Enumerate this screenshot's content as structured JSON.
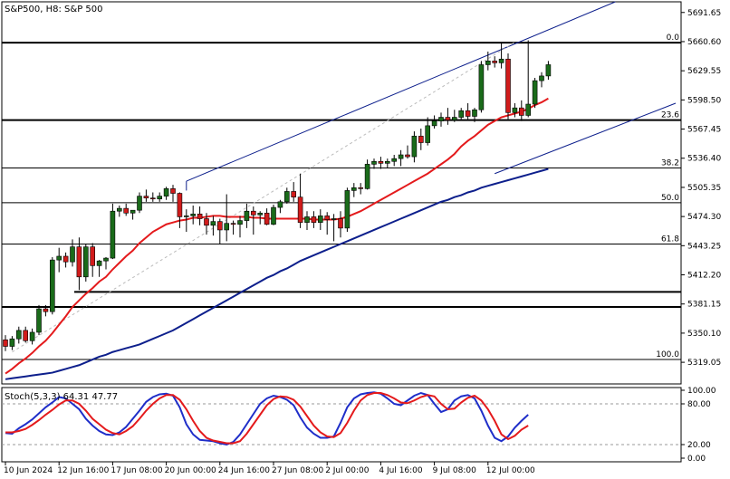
{
  "header": {
    "title": "S&P500, H8:  S&P 500"
  },
  "colors": {
    "bull": "#1a6b1a",
    "bear": "#d11b1b",
    "wick": "#000000",
    "ma_fast": "#e41a1c",
    "ma_slow": "#0d1f8c",
    "channel": "#0d1f8c",
    "level": "#000000",
    "stoch_k": "#1f2ec9",
    "stoch_d": "#e41a1c"
  },
  "chart_data": [
    {
      "type": "candlestick",
      "title": "S&P500, H8:  S&P 500",
      "ylim": [
        5296,
        5703
      ],
      "y_ticks": [
        "5691.65",
        "5660.60",
        "5629.55",
        "5598.50",
        "5567.45",
        "5536.40",
        "5505.35",
        "5474.30",
        "5443.25",
        "5412.20",
        "5381.15",
        "5350.10",
        "5319.05"
      ],
      "x_ticks": [
        {
          "label": "10 Jun 2024",
          "i": 0
        },
        {
          "label": "12 Jun 16:00",
          "i": 8
        },
        {
          "label": "17 Jun 08:00",
          "i": 16
        },
        {
          "label": "20 Jun 00:00",
          "i": 24
        },
        {
          "label": "24 Jun 16:00",
          "i": 32
        },
        {
          "label": "27 Jun 08:00",
          "i": 40
        },
        {
          "label": "2 Jul 00:00",
          "i": 48
        },
        {
          "label": "4 Jul 16:00",
          "i": 56
        },
        {
          "label": "9 Jul 08:00",
          "i": 64
        },
        {
          "label": "12 Jul 00:00",
          "i": 72
        }
      ],
      "candles": [
        [
          5343,
          5348,
          5331,
          5336
        ],
        [
          5336,
          5347,
          5332,
          5344
        ],
        [
          5344,
          5357,
          5339,
          5353
        ],
        [
          5353,
          5357,
          5340,
          5342
        ],
        [
          5342,
          5355,
          5338,
          5351
        ],
        [
          5351,
          5380,
          5348,
          5376
        ],
        [
          5376,
          5380,
          5368,
          5373
        ],
        [
          5373,
          5431,
          5370,
          5428
        ],
        [
          5428,
          5441,
          5415,
          5432
        ],
        [
          5432,
          5436,
          5420,
          5426
        ],
        [
          5426,
          5450,
          5421,
          5442
        ],
        [
          5442,
          5452,
          5396,
          5410
        ],
        [
          5410,
          5445,
          5405,
          5442
        ],
        [
          5442,
          5446,
          5410,
          5422
        ],
        [
          5422,
          5428,
          5410,
          5427
        ],
        [
          5427,
          5431,
          5418,
          5430
        ],
        [
          5430,
          5488,
          5429,
          5480
        ],
        [
          5480,
          5486,
          5474,
          5483
        ],
        [
          5483,
          5488,
          5475,
          5478
        ],
        [
          5478,
          5481,
          5471,
          5481
        ],
        [
          5481,
          5500,
          5478,
          5496
        ],
        [
          5496,
          5503,
          5490,
          5494
        ],
        [
          5494,
          5500,
          5490,
          5493
        ],
        [
          5493,
          5500,
          5490,
          5496
        ],
        [
          5496,
          5506,
          5492,
          5504
        ],
        [
          5504,
          5508,
          5490,
          5499
        ],
        [
          5499,
          5500,
          5462,
          5474
        ],
        [
          5474,
          5482,
          5458,
          5475
        ],
        [
          5475,
          5486,
          5466,
          5477
        ],
        [
          5477,
          5485,
          5465,
          5472
        ],
        [
          5472,
          5478,
          5455,
          5465
        ],
        [
          5465,
          5475,
          5454,
          5469
        ],
        [
          5469,
          5472,
          5445,
          5460
        ],
        [
          5460,
          5498,
          5448,
          5467
        ],
        [
          5467,
          5470,
          5455,
          5466
        ],
        [
          5466,
          5475,
          5452,
          5470
        ],
        [
          5470,
          5488,
          5462,
          5480
        ],
        [
          5480,
          5485,
          5455,
          5476
        ],
        [
          5476,
          5480,
          5466,
          5478
        ],
        [
          5478,
          5483,
          5465,
          5466
        ],
        [
          5466,
          5487,
          5465,
          5484
        ],
        [
          5484,
          5492,
          5478,
          5490
        ],
        [
          5490,
          5505,
          5488,
          5501
        ],
        [
          5501,
          5511,
          5490,
          5495
        ],
        [
          5495,
          5520,
          5462,
          5468
        ],
        [
          5468,
          5480,
          5460,
          5474
        ],
        [
          5474,
          5480,
          5462,
          5468
        ],
        [
          5468,
          5482,
          5460,
          5475
        ],
        [
          5475,
          5479,
          5455,
          5471
        ],
        [
          5471,
          5477,
          5448,
          5472
        ],
        [
          5472,
          5480,
          5452,
          5462
        ],
        [
          5462,
          5505,
          5458,
          5502
        ],
        [
          5502,
          5510,
          5495,
          5505
        ],
        [
          5505,
          5510,
          5498,
          5504
        ],
        [
          5504,
          5535,
          5503,
          5530
        ],
        [
          5530,
          5536,
          5525,
          5533
        ],
        [
          5533,
          5538,
          5525,
          5531
        ],
        [
          5531,
          5536,
          5526,
          5533
        ],
        [
          5533,
          5540,
          5528,
          5536
        ],
        [
          5536,
          5545,
          5528,
          5540
        ],
        [
          5540,
          5550,
          5536,
          5538
        ],
        [
          5538,
          5565,
          5532,
          5560
        ],
        [
          5560,
          5568,
          5545,
          5553
        ],
        [
          5553,
          5580,
          5550,
          5571
        ],
        [
          5571,
          5582,
          5568,
          5576
        ],
        [
          5576,
          5585,
          5570,
          5580
        ],
        [
          5580,
          5590,
          5572,
          5577
        ],
        [
          5577,
          5588,
          5575,
          5580
        ],
        [
          5580,
          5590,
          5578,
          5587
        ],
        [
          5587,
          5595,
          5578,
          5581
        ],
        [
          5581,
          5590,
          5575,
          5588
        ],
        [
          5588,
          5640,
          5585,
          5636
        ],
        [
          5636,
          5650,
          5630,
          5640
        ],
        [
          5640,
          5645,
          5633,
          5638
        ],
        [
          5638,
          5660,
          5632,
          5642
        ],
        [
          5642,
          5648,
          5578,
          5585
        ],
        [
          5585,
          5595,
          5580,
          5590
        ],
        [
          5590,
          5598,
          5576,
          5582
        ],
        [
          5582,
          5662,
          5580,
          5594
        ],
        [
          5594,
          5622,
          5590,
          5619
        ],
        [
          5619,
          5628,
          5612,
          5624
        ],
        [
          5624,
          5640,
          5620,
          5636
        ]
      ],
      "ma_fast": [
        5307,
        5312,
        5318,
        5323,
        5329,
        5336,
        5342,
        5350,
        5359,
        5368,
        5378,
        5385,
        5392,
        5398,
        5405,
        5410,
        5418,
        5425,
        5432,
        5438,
        5446,
        5452,
        5458,
        5462,
        5466,
        5468,
        5470,
        5471,
        5473,
        5473,
        5474,
        5475,
        5475,
        5474,
        5474,
        5474,
        5474,
        5473,
        5473,
        5472,
        5472,
        5472,
        5472,
        5472,
        5472,
        5472,
        5471,
        5471,
        5471,
        5471,
        5472,
        5474,
        5477,
        5480,
        5484,
        5488,
        5492,
        5496,
        5500,
        5504,
        5508,
        5512,
        5516,
        5520,
        5525,
        5530,
        5535,
        5541,
        5549,
        5555,
        5560,
        5566,
        5572,
        5576,
        5580,
        5582,
        5584,
        5586,
        5589,
        5593,
        5596,
        5600
      ],
      "ma_slow": [
        5301,
        5302,
        5303,
        5304,
        5305,
        5306,
        5307,
        5308,
        5310,
        5312,
        5314,
        5316,
        5319,
        5322,
        5325,
        5327,
        5330,
        5332,
        5334,
        5336,
        5338,
        5341,
        5344,
        5347,
        5350,
        5353,
        5357,
        5361,
        5365,
        5369,
        5373,
        5377,
        5381,
        5385,
        5389,
        5393,
        5397,
        5401,
        5405,
        5409,
        5412,
        5416,
        5419,
        5423,
        5427,
        5430,
        5433,
        5436,
        5439,
        5442,
        5445,
        5448,
        5451,
        5454,
        5457,
        5460,
        5463,
        5466,
        5469,
        5472,
        5475,
        5478,
        5481,
        5484,
        5487,
        5490,
        5492,
        5495,
        5497,
        5500,
        5502,
        5505,
        5507,
        5509,
        5511,
        5513,
        5515,
        5517,
        5519,
        5521,
        5523,
        5525
      ],
      "horizontal_levels": [
        5659.5,
        5577,
        5526,
        5489,
        5445,
        5394,
        5378,
        5322
      ],
      "fibonacci": [
        {
          "label": "0.0",
          "price": 5659.5
        },
        {
          "label": "23.6",
          "price": 5577
        },
        {
          "label": "38.2",
          "price": 5526
        },
        {
          "label": "50.0",
          "price": 5489
        },
        {
          "label": "61.8",
          "price": 5445
        },
        {
          "label": "100.0",
          "price": 5322
        }
      ]
    },
    {
      "type": "line",
      "title": "Stoch(5,3,3) 64.31 47.77",
      "ylim": [
        0,
        100
      ],
      "y_ticks": [
        "100.00",
        "80.00",
        "20.00",
        "0.00"
      ],
      "levels": [
        80,
        20
      ],
      "series": [
        {
          "name": "%K",
          "values": [
            37,
            36,
            44,
            50,
            57,
            66,
            75,
            82,
            90,
            88,
            80,
            72,
            58,
            48,
            40,
            35,
            34,
            38,
            46,
            58,
            70,
            83,
            90,
            94,
            95,
            92,
            75,
            50,
            35,
            27,
            26,
            25,
            22,
            20,
            24,
            35,
            50,
            65,
            80,
            88,
            92,
            90,
            86,
            78,
            60,
            45,
            36,
            30,
            30,
            32,
            52,
            75,
            88,
            94,
            96,
            97,
            95,
            88,
            80,
            78,
            85,
            92,
            96,
            93,
            80,
            68,
            72,
            85,
            91,
            93,
            88,
            70,
            48,
            30,
            25,
            32,
            45,
            55,
            64
          ]
        },
        {
          "name": "%D",
          "values": [
            38,
            38,
            40,
            43,
            49,
            56,
            64,
            71,
            79,
            85,
            85,
            80,
            70,
            58,
            50,
            42,
            37,
            35,
            40,
            47,
            58,
            70,
            80,
            88,
            93,
            93,
            86,
            72,
            55,
            40,
            30,
            26,
            24,
            22,
            22,
            25,
            36,
            50,
            64,
            78,
            87,
            91,
            90,
            86,
            76,
            62,
            48,
            38,
            32,
            31,
            37,
            52,
            70,
            85,
            93,
            96,
            96,
            93,
            88,
            82,
            81,
            85,
            90,
            93,
            91,
            80,
            72,
            73,
            82,
            89,
            92,
            85,
            72,
            55,
            35,
            28,
            33,
            42,
            48
          ]
        }
      ],
      "x_ticks": [
        "10 Jun 2024",
        "12 Jun 16:00",
        "17 Jun 08:00",
        "20 Jun 00:00",
        "24 Jun 16:00",
        "27 Jun 08:00",
        "2 Jul 00:00",
        "4 Jul 16:00",
        "9 Jul 08:00",
        "12 Jul 00:00"
      ]
    }
  ]
}
